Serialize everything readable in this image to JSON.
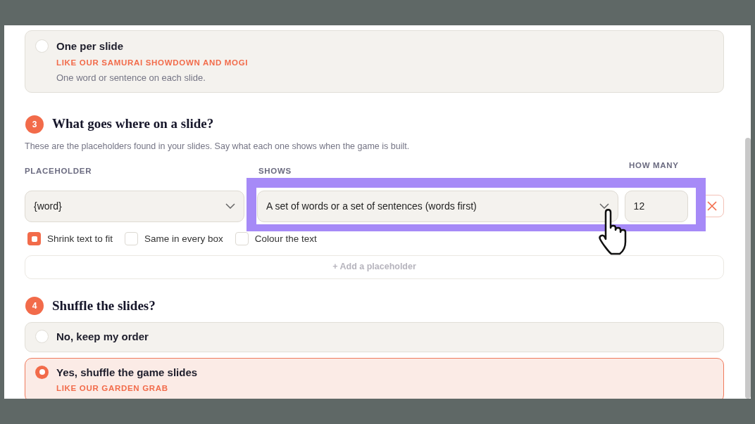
{
  "previous_options": [
    {
      "label": "One per slide",
      "tagline": "LIKE OUR SAMURAI SHOWDOWN AND MOGI",
      "description": "One word or sentence on each slide.",
      "selected": false
    }
  ],
  "step_3": {
    "number": "3",
    "title": "What goes where on a slide?",
    "description": "These are the placeholders found in your slides. Say what each one shows when the game is built.",
    "columns": [
      "PLACEHOLDER",
      "SHOWS",
      "HOW MANY"
    ],
    "rows": [
      {
        "placeholder": "{word}",
        "shows": "A set of words or a set of sentences (words first)",
        "count": "12",
        "options": [
          {
            "label": "Shrink text to fit",
            "checked": true
          },
          {
            "label": "Same in every box",
            "checked": false
          },
          {
            "label": "Colour the text",
            "checked": false
          }
        ]
      }
    ],
    "add_button": "+ Add a placeholder"
  },
  "step_4": {
    "number": "4",
    "title": "Shuffle the slides?",
    "options": [
      {
        "label": "No, keep my order",
        "selected": false
      },
      {
        "label": "Yes, shuffle the game slides",
        "tagline": "LIKE OUR GARDEN GRAB",
        "selected": true
      }
    ]
  }
}
